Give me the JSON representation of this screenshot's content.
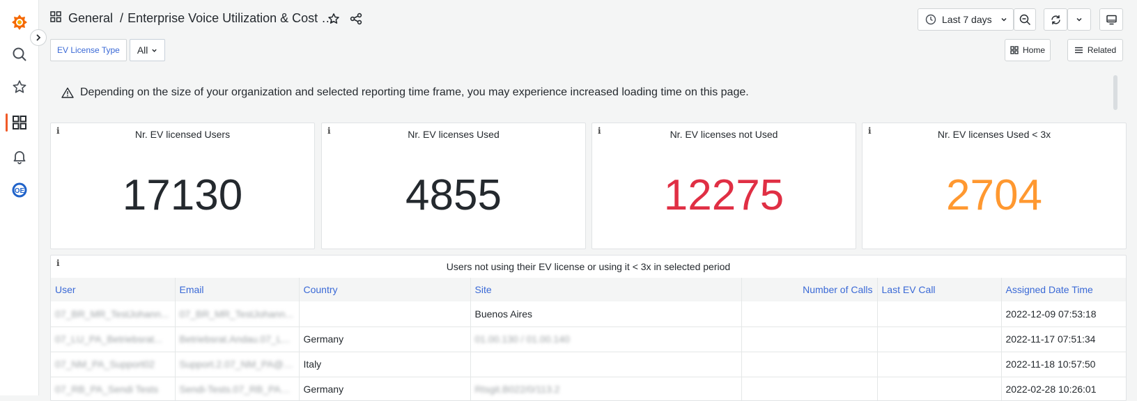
{
  "sidebar": {
    "items": [
      {
        "icon": "grafana-logo-icon"
      },
      {
        "icon": "search-icon"
      },
      {
        "icon": "star-icon"
      },
      {
        "icon": "dashboards-icon",
        "active": true
      },
      {
        "icon": "bell-icon"
      },
      {
        "icon": "app-plugin-icon"
      }
    ],
    "accent": "#f05a28"
  },
  "header": {
    "folder": "General",
    "separator": "/",
    "title": "Enterprise Voice Utilization & Cost O...",
    "time_range": "Last 7 days"
  },
  "variables": {
    "license_type_label": "EV License Type",
    "license_type_value": "All"
  },
  "links": {
    "home": "Home",
    "related": "Related"
  },
  "banner": {
    "text": "Depending on the size of your organization and selected reporting time frame, you may experience increased loading time on this page."
  },
  "stats": [
    {
      "label": "Nr. EV licensed Users",
      "value": "17130",
      "color": "#24292e"
    },
    {
      "label": "Nr. EV licenses Used",
      "value": "4855",
      "color": "#24292e"
    },
    {
      "label": "Nr. EV licenses not Used",
      "value": "12275",
      "color": "#e02f44"
    },
    {
      "label": "Nr. EV licenses Used < 3x",
      "value": "2704",
      "color": "#ff9830"
    }
  ],
  "table": {
    "title": "Users not using their EV license or using it < 3x in selected period",
    "columns": [
      "User",
      "Email",
      "Country",
      "Site",
      "Number of Calls",
      "Last EV Call",
      "Assigned Date Time"
    ],
    "rows": [
      {
        "user": "07_BR_MR_TestJohann...",
        "email": "07_BR_MR_TestJohann...",
        "country": "",
        "site": "Buenos Aires",
        "calls": "",
        "last_call": "",
        "assigned": "2022-12-09 07:53:18"
      },
      {
        "user": "07_LU_PA_Betriebsrat...",
        "email": "Betriebsrat.Andau.07_L...",
        "country": "Germany",
        "site": "01.00.130 / 01.00.140",
        "calls": "",
        "last_call": "",
        "assigned": "2022-11-17 07:51:34"
      },
      {
        "user": "07_NM_PA_Support02",
        "email": "Support.2.07_NM_PA@c...",
        "country": "Italy",
        "site": "",
        "calls": "",
        "last_call": "",
        "assigned": "2022-11-18 10:57:50"
      },
      {
        "user": "07_RB_PA_Sendi Tests",
        "email": "Sendi-Tests.07_RB_PA@...",
        "country": "Germany",
        "site": "Rtsgit.B022/0/113.2",
        "calls": "",
        "last_call": "",
        "assigned": "2022-02-28 10:26:01"
      }
    ]
  }
}
